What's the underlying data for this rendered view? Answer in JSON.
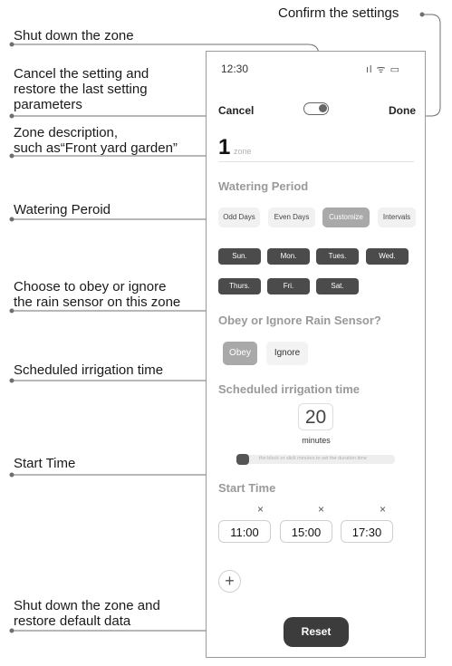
{
  "callouts": {
    "confirm": "Confirm the settings",
    "shutdown": "Shut down the zone",
    "cancel": "Cancel the setting and\nrestore the last setting\nparameters",
    "zone_desc": "Zone description,\nsuch as“Front yard garden”",
    "watering": "Watering Peroid",
    "rain": "Choose to obey or ignore\nthe rain sensor on this zone",
    "scheduled": "Scheduled irrigation time",
    "start": "Start Time",
    "reset": "Shut down the zone and\nrestore default data"
  },
  "status_bar": {
    "time": "12:30",
    "icons": "ıl ᯤ ▭"
  },
  "header": {
    "cancel_label": "Cancel",
    "done_label": "Done"
  },
  "zone": {
    "number": "1",
    "placeholder": "zone"
  },
  "watering": {
    "title": "Watering Period",
    "modes": [
      "Odd Days",
      "Even Days",
      "Customize",
      "Intervals"
    ],
    "selected_mode": "Customize",
    "days": [
      "Sun.",
      "Mon.",
      "Tues.",
      "Wed.",
      "Thurs.",
      "Fri.",
      "Sat."
    ]
  },
  "rain_sensor": {
    "title": "Obey or Ignore Rain Sensor?",
    "obey_label": "Obey",
    "ignore_label": "Ignore",
    "selected": "Obey"
  },
  "scheduled": {
    "title": "Scheduled irrigation time",
    "value": "20",
    "unit": "minutes",
    "hint": "the block or slick minutes to set the duration time"
  },
  "start_time": {
    "title": "Start Time",
    "times": [
      "11:00",
      "15:00",
      "17:30"
    ],
    "add_label": "+",
    "remove_label": "×"
  },
  "reset_label": "Reset"
}
